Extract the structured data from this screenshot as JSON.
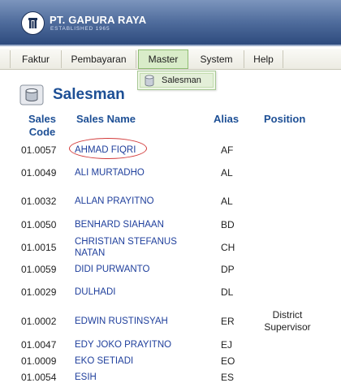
{
  "header": {
    "company_name": "PT. GAPURA RAYA",
    "company_sub": "ESTABLISHED 1965"
  },
  "menu": [
    {
      "label": "Faktur"
    },
    {
      "label": "Pembayaran"
    },
    {
      "label": "Master",
      "active": true
    },
    {
      "label": "System"
    },
    {
      "label": "Help"
    }
  ],
  "dropdown": {
    "items": [
      {
        "label": "Salesman",
        "icon": "salesman-icon"
      }
    ]
  },
  "page": {
    "title": "Salesman",
    "title_icon": "salesman-icon"
  },
  "table": {
    "columns": {
      "code": "Sales Code",
      "code_line1": "Sales",
      "code_line2": "Code",
      "name": "Sales Name",
      "alias": "Alias",
      "position": "Position"
    },
    "rows": [
      {
        "code": "01.0057",
        "name": "AHMAD FIQRI",
        "alias": "AF",
        "position": "",
        "highlighted": true
      },
      {
        "code": "01.0049",
        "name": "ALI MURTADHO",
        "alias": "AL",
        "position": ""
      },
      {
        "code": "01.0032",
        "name": "ALLAN PRAYITNO",
        "alias": "AL",
        "position": ""
      },
      {
        "code": "01.0050",
        "name": "BENHARD SIAHAAN",
        "alias": "BD",
        "position": ""
      },
      {
        "code": "01.0015",
        "name": "CHRISTIAN STEFANUS NATAN",
        "alias": "CH",
        "position": ""
      },
      {
        "code": "01.0059",
        "name": "DIDI PURWANTO",
        "alias": "DP",
        "position": ""
      },
      {
        "code": "01.0029",
        "name": "DULHADI",
        "alias": "DL",
        "position": ""
      },
      {
        "code": "01.0002",
        "name": "EDWIN RUSTINSYAH",
        "alias": "ER",
        "position": "District Supervisor"
      },
      {
        "code": "01.0047",
        "name": "EDY JOKO PRAYITNO",
        "alias": "EJ",
        "position": ""
      },
      {
        "code": "01.0009",
        "name": "EKO SETIADI",
        "alias": "EO",
        "position": ""
      },
      {
        "code": "01.0054",
        "name": "ESIH",
        "alias": "ES",
        "position": ""
      }
    ]
  },
  "colors": {
    "header_top": "#7c95bd",
    "header_bottom": "#2d4a7d",
    "title": "#1d4f95",
    "link": "#1f3f9c",
    "menu_active": "#d9ecc9",
    "highlight": "#d23a3a"
  }
}
